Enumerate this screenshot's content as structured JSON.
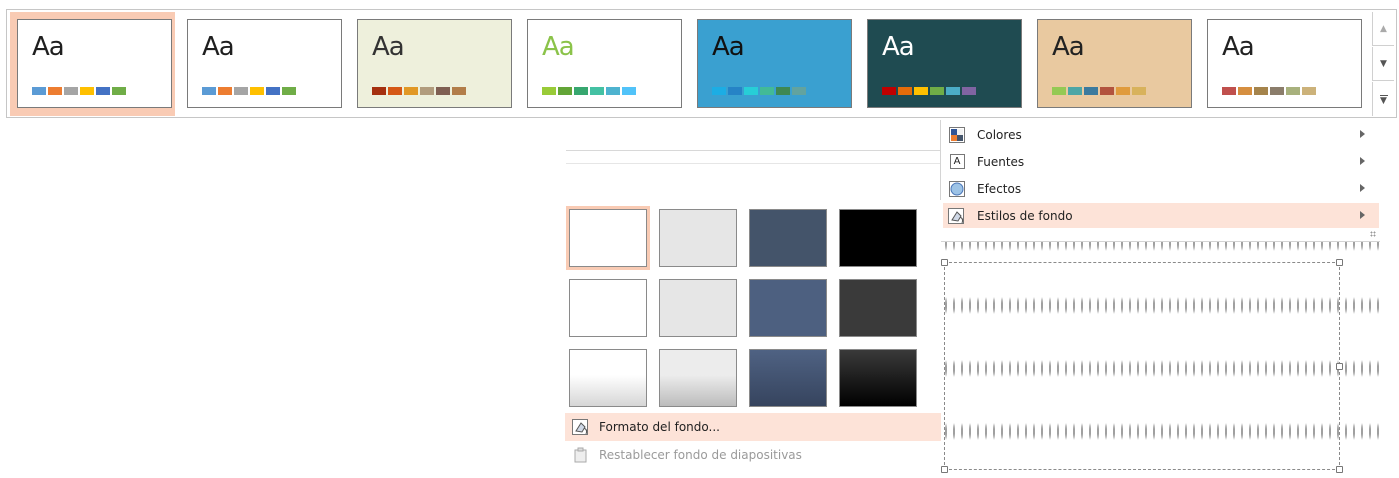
{
  "themes": [
    {
      "label": "Aa",
      "selected": true,
      "bg": "#ffffff",
      "text_color": "#1f1f1f",
      "swatches": [
        "#5b9bd5",
        "#ed7d31",
        "#a5a5a5",
        "#ffc000",
        "#4472c4",
        "#70ad47"
      ]
    },
    {
      "label": "Aa",
      "selected": false,
      "bg": "#ffffff",
      "text_color": "#1f1f1f",
      "swatches": [
        "#5b9bd5",
        "#ed7d31",
        "#a5a5a5",
        "#ffc000",
        "#4472c4",
        "#70ad47"
      ]
    },
    {
      "label": "Aa",
      "selected": false,
      "bg": "#eef0dc",
      "text_color": "#333333",
      "swatches": [
        "#a5300f",
        "#d55816",
        "#e19825",
        "#b19c7d",
        "#7f5f52",
        "#b27d49"
      ]
    },
    {
      "label": "Aa",
      "selected": false,
      "bg": "#ffffff",
      "text_color": "#8bc34a",
      "swatches": [
        "#99cb38",
        "#63a537",
        "#37a76f",
        "#44c1a3",
        "#4eb3cf",
        "#51c3f9"
      ]
    },
    {
      "label": "Aa",
      "selected": false,
      "bg": "#3aa0d0",
      "text_color": "#111111",
      "swatches": [
        "#1cade4",
        "#2683c6",
        "#27ced7",
        "#42ba97",
        "#3e8853",
        "#62a39f"
      ]
    },
    {
      "label": "Aa",
      "selected": false,
      "bg": "#1f4b51",
      "text_color": "#ffffff",
      "swatches": [
        "#c00000",
        "#e46c0a",
        "#ffc000",
        "#70ad47",
        "#4bacc6",
        "#8064a2"
      ]
    },
    {
      "label": "Aa",
      "selected": false,
      "bg": "#e9c9a0",
      "text_color": "#222222",
      "swatches": [
        "#94c954",
        "#4da6a6",
        "#3b7a9e",
        "#b2533e",
        "#e09b3d",
        "#d8b25c"
      ]
    },
    {
      "label": "Aa",
      "selected": false,
      "bg": "#ffffff",
      "text_color": "#222222",
      "swatches": [
        "#c0504d",
        "#d68f40",
        "#a5844c",
        "#8b7d6b",
        "#a8b17d",
        "#ccb27a"
      ]
    }
  ],
  "gallery_scroll": {
    "up": "▲",
    "down": "▼"
  },
  "variants_menu": [
    {
      "label": "Colores",
      "icon": "color-palette-icon",
      "highlighted": false
    },
    {
      "label": "Fuentes",
      "icon": "font-icon",
      "highlighted": false
    },
    {
      "label": "Efectos",
      "icon": "effects-icon",
      "highlighted": false
    },
    {
      "label": "Estilos de fondo",
      "icon": "background-style-icon",
      "highlighted": true
    }
  ],
  "font_icon_letter": "A",
  "background_styles": [
    {
      "fill": "#ffffff",
      "selected": true
    },
    {
      "fill": "#e6e6e6",
      "selected": false
    },
    {
      "fill": "#44546a",
      "selected": false
    },
    {
      "fill": "#000000",
      "selected": false
    },
    {
      "fill": "#ffffff",
      "selected": false
    },
    {
      "fill": "#e6e6e6",
      "selected": false
    },
    {
      "fill": "#4d6080",
      "selected": false
    },
    {
      "fill": "#3a3a3a",
      "selected": false
    },
    {
      "fill": "linear-gradient(#ffffff 45%, #d6d6d6)",
      "selected": false
    },
    {
      "fill": "linear-gradient(#ececec 45%, #bcbcbc)",
      "selected": false
    },
    {
      "fill": "linear-gradient(#4f6283, #36445e)",
      "selected": false
    },
    {
      "fill": "linear-gradient(#3a3a3a, #000000)",
      "selected": false
    }
  ],
  "panel_commands": {
    "format_background": "Formato del fondo...",
    "reset_background": "Restablecer fondo de diapositivas"
  },
  "colors": {
    "highlight": "#fde3d8",
    "selected_border": "#f9cbb4"
  }
}
